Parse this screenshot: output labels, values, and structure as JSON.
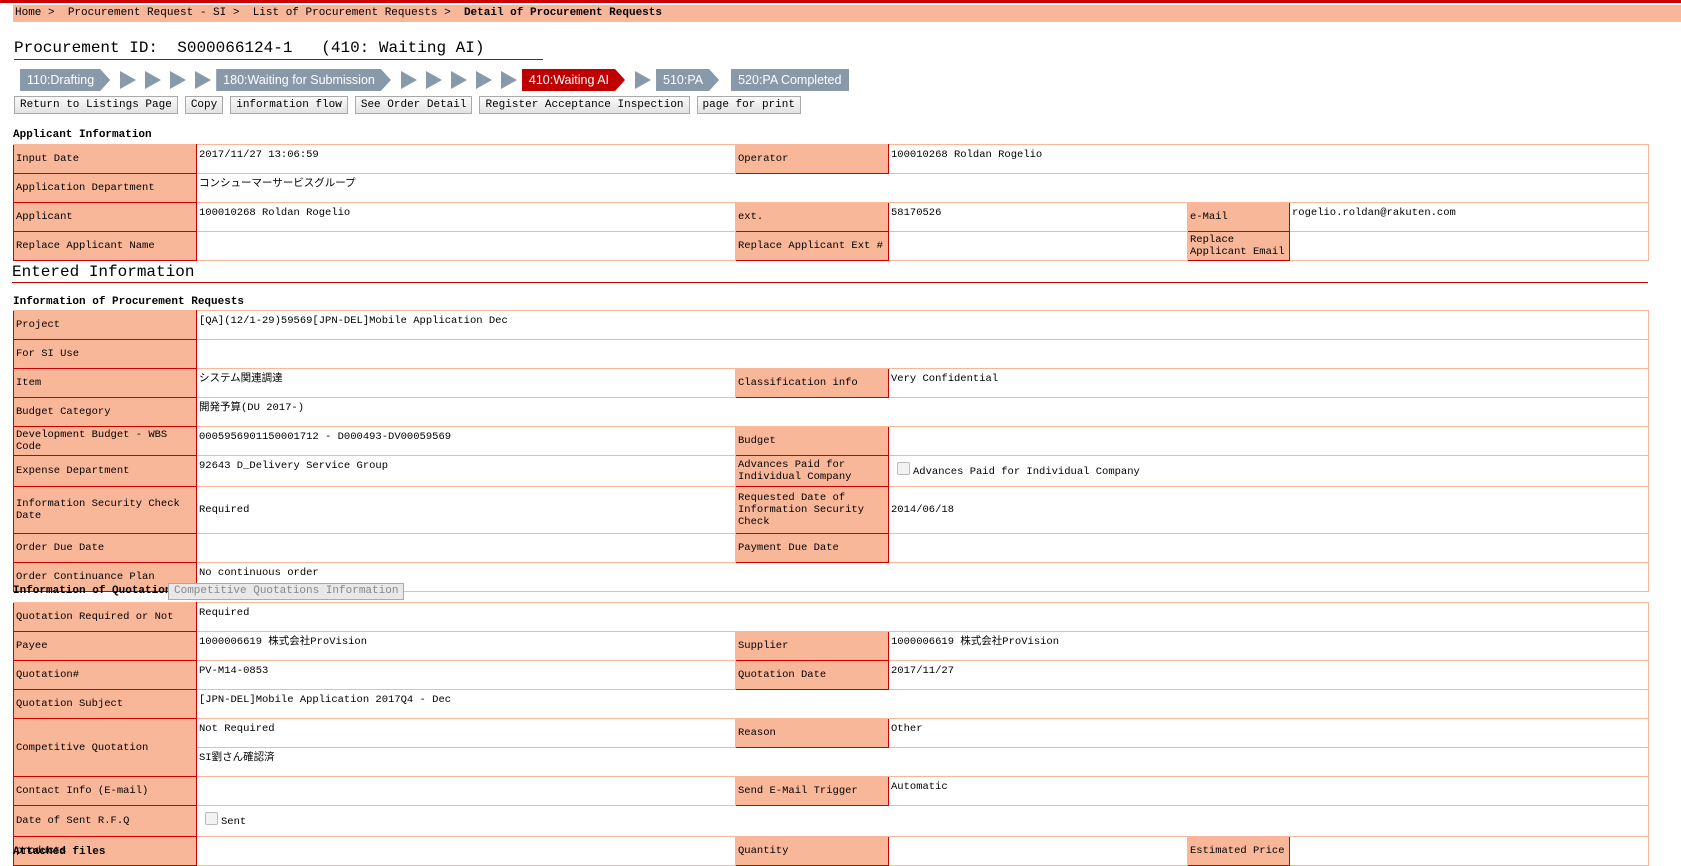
{
  "breadcrumb": {
    "items": [
      "Home",
      "Procurement Request - SI",
      "List of Procurement Requests"
    ],
    "current": "Detail of Procurement Requests"
  },
  "header": {
    "id_label": "Procurement ID:",
    "id_value": "S000066124-1   (410: Waiting AI)"
  },
  "steps": [
    {
      "label": "110:Drafting",
      "arrows_after": 4
    },
    {
      "label": "180:Waiting for Submission",
      "arrows_after": 5
    },
    {
      "label": "410:Waiting AI",
      "active": true,
      "arrows_after": 1
    },
    {
      "label": "510:PA",
      "arrows_after": 0
    },
    {
      "label": "520:PA Completed",
      "last": true,
      "arrows_after": 0
    }
  ],
  "buttons": [
    "Return to Listings Page",
    "Copy",
    "information flow",
    "See Order Detail",
    "Register Acceptance Inspection",
    "page for print"
  ],
  "applicant": {
    "title": "Applicant Information",
    "rows": [
      [
        {
          "label": "Input Date",
          "value": "2017/11/27 13:06:59"
        },
        {
          "label": "Operator",
          "value": "100010268  Roldan Rogelio"
        }
      ],
      [
        {
          "label": "Application Department",
          "value": "コンシューマーサービスグループ"
        }
      ],
      [
        {
          "label": "Applicant",
          "value": "100010268  Roldan Rogelio"
        },
        {
          "label": "ext.",
          "value": "58170526"
        },
        {
          "label": "e-Mail",
          "value": "rogelio.roldan@rakuten.com"
        }
      ],
      [
        {
          "label": "Replace Applicant Name",
          "value": ""
        },
        {
          "label": "Replace Applicant Ext #",
          "value": ""
        },
        {
          "label": "Replace Applicant Email",
          "value": ""
        }
      ]
    ]
  },
  "entered_title": "Entered Information",
  "procurement": {
    "title": "Information of Procurement Requests",
    "rows": [
      [
        {
          "label": "Project",
          "value": "[QA](12/1-29)59569[JPN-DEL]Mobile Application Dec"
        }
      ],
      [
        {
          "label": "For SI Use",
          "value": ""
        }
      ],
      [
        {
          "label": "Item",
          "value": "システム関連調達"
        },
        {
          "label": "Classification info",
          "value": "Very Confidential"
        }
      ],
      [
        {
          "label": "Budget Category",
          "value": "開発予算(DU 2017-)"
        }
      ],
      [
        {
          "label": "Development Budget - WBS Code",
          "value": "0005956901150001712  -  D000493-DV00059569"
        },
        {
          "label": "Budget",
          "value": ""
        }
      ],
      [
        {
          "label": "Expense Department",
          "value": "92643  D_Delivery Service Group"
        },
        {
          "label": "Advances Paid for Individual Company",
          "checkbox": "Advances Paid for Individual Company"
        }
      ],
      [
        {
          "label": "Information Security Check Date",
          "value": "Required"
        },
        {
          "label": "Requested Date of Information Security Check",
          "value": "2014/06/18"
        }
      ],
      [
        {
          "label": "Order Due Date",
          "value": ""
        },
        {
          "label": "Payment Due Date",
          "value": ""
        }
      ],
      [
        {
          "label": "Order Continuance Plan",
          "value": "No continuous order"
        }
      ]
    ]
  },
  "quotation": {
    "title": "Information of Quotation",
    "competitive_button": "Competitive Quotations Information",
    "rows": [
      [
        {
          "label": "Quotation Required or Not",
          "value": "Required"
        }
      ],
      [
        {
          "label": "Payee",
          "value": "1000006619  株式会社ProVision"
        },
        {
          "label": "Supplier",
          "value": "1000006619  株式会社ProVision"
        }
      ],
      [
        {
          "label": "Quotation#",
          "value": "PV-M14-0853"
        },
        {
          "label": "Quotation Date",
          "value": "2017/11/27"
        }
      ],
      [
        {
          "label": "Quotation Subject",
          "value": "[JPN-DEL]Mobile Application 2017Q4 - Dec"
        }
      ],
      [
        {
          "label": "Competitive Quotation",
          "value": "Not Required",
          "rowspan2": "SI劉さん確認済"
        },
        {
          "label": "Reason",
          "value": "Other"
        }
      ],
      [
        {
          "label": "Contact Info (E-mail)",
          "value": ""
        },
        {
          "label": "Send E-Mail Trigger",
          "value": "Automatic"
        }
      ],
      [
        {
          "label": "Date of Sent R.F.Q",
          "checkbox": "Sent"
        }
      ],
      [
        {
          "label": "products",
          "value": ""
        },
        {
          "label": "Quantity",
          "value": ""
        },
        {
          "label": "Estimated Price",
          "value": ""
        }
      ]
    ]
  },
  "attached_title": "Attached files"
}
